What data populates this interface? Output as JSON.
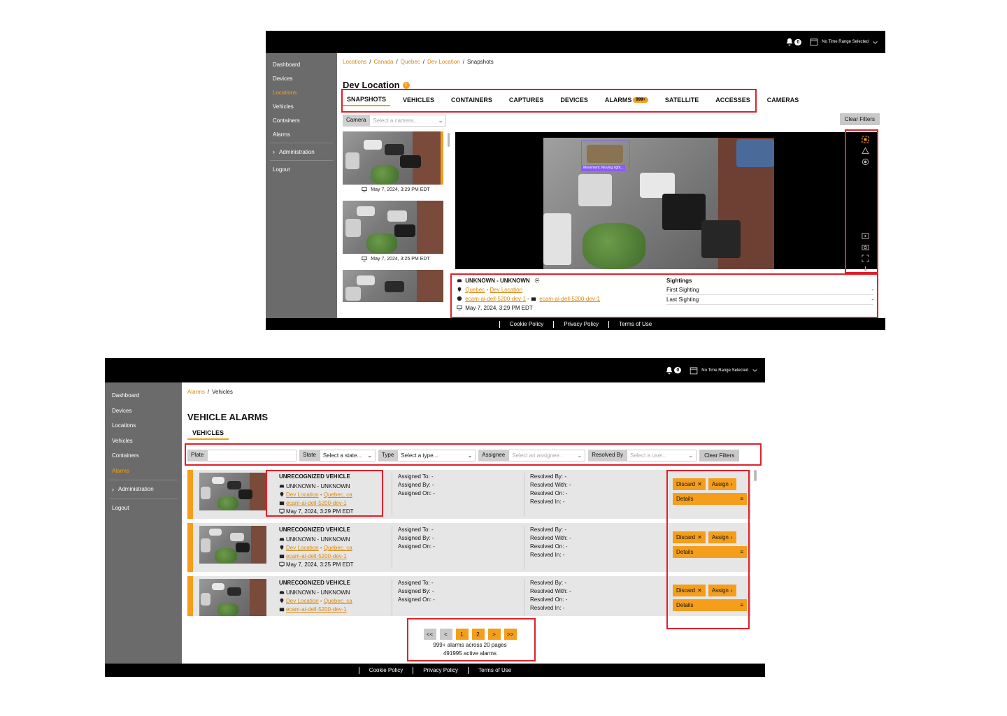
{
  "header": {
    "notification_count": "0",
    "time_range": "No Time Range Selected"
  },
  "sidebar": {
    "items": [
      "Dashboard",
      "Devices",
      "Locations",
      "Vehicles",
      "Containers",
      "Alarms"
    ],
    "administration": "Administration",
    "logout": "Logout"
  },
  "footer": {
    "cookie": "Cookie Policy",
    "privacy": "Privacy Policy",
    "terms": "Terms of Use"
  },
  "snapshots_page": {
    "breadcrumb": [
      "Locations",
      "Canada",
      "Quebec",
      "Dev Location",
      "Snapshots"
    ],
    "title": "Dev Location",
    "warning_glyph": "!",
    "tabs": [
      "SNAPSHOTS",
      "VEHICLES",
      "CONTAINERS",
      "CAPTURES",
      "DEVICES",
      "ALARMS",
      "SATELLITE",
      "ACCESSES",
      "CAMERAS"
    ],
    "alarms_badge": "999+",
    "camera_label": "Camera",
    "camera_placeholder": "Select a camera...",
    "clear_filters": "Clear Filters",
    "thumbnails": [
      "May 7, 2024, 3:29 PM EDT",
      "May 7, 2024, 3:25 PM EDT",
      ""
    ],
    "detection_label": "Movement: Moving right...",
    "info": {
      "vehicle": "UNKNOWN - UNKNOWN",
      "location_region": "Quebec",
      "location_name": "Dev Location",
      "device": "ecam-ai-dell-5200-dev-1",
      "camera": "ecam-ai-dell-5200-dev-1",
      "timestamp": "May 7, 2024, 3:29 PM EDT",
      "sightings_title": "Sightings",
      "first_sighting": "First Sighting",
      "first_sighting_value": "-",
      "last_sighting": "Last Sighting",
      "last_sighting_value": "-"
    }
  },
  "alarms_page": {
    "breadcrumb": [
      "Alarms",
      "Vehicles"
    ],
    "title": "VEHICLE ALARMS",
    "tab": "VEHICLES",
    "filters": {
      "plate_label": "Plate",
      "plate_value": "",
      "state_label": "State",
      "state_value": "Select a state...",
      "type_label": "Type",
      "type_value": "Select a type...",
      "assignee_label": "Assignee",
      "assignee_placeholder": "Select an assignee...",
      "resolved_by_label": "Resolved By",
      "resolved_by_placeholder": "Select a user...",
      "clear": "Clear Filters"
    },
    "alarms": [
      {
        "title": "UNRECOGNIZED VEHICLE",
        "vehicle": "UNKNOWN - UNKNOWN",
        "location": "Dev Location",
        "region": "Quebec, ca",
        "camera": "ecam-ai-dell-5200-dev-1",
        "timestamp": "May 7, 2024, 3:29 PM EDT",
        "assigned_to": "Assigned To: -",
        "assigned_by": "Assigned By: -",
        "assigned_on": "Assigned On: -",
        "resolved_by": "Resolved By: -",
        "resolved_with": "Resolved With: -",
        "resolved_on": "Resolved On: -",
        "resolved_in": "Resolved In: -"
      },
      {
        "title": "UNRECOGNIZED VEHICLE",
        "vehicle": "UNKNOWN - UNKNOWN",
        "location": "Dev Location",
        "region": "Quebec, ca",
        "camera": "ecam-ai-dell-5200-dev-1",
        "timestamp": "May 7, 2024, 3:25 PM EDT",
        "assigned_to": "Assigned To: -",
        "assigned_by": "Assigned By: -",
        "assigned_on": "Assigned On: -",
        "resolved_by": "Resolved By: -",
        "resolved_with": "Resolved With: -",
        "resolved_on": "Resolved On: -",
        "resolved_in": "Resolved In: -"
      },
      {
        "title": "UNRECOGNIZED VEHICLE",
        "vehicle": "UNKNOWN - UNKNOWN",
        "location": "Dev Location",
        "region": "Quebec, ca",
        "camera": "ecam-ai-dell-5200-dev-1",
        "timestamp": "",
        "assigned_to": "Assigned To: -",
        "assigned_by": "Assigned By: -",
        "assigned_on": "Assigned On: -",
        "resolved_by": "Resolved By: -",
        "resolved_with": "Resolved With: -",
        "resolved_on": "Resolved On: -",
        "resolved_in": "Resolved In: -"
      }
    ],
    "actions": {
      "discard": "Discard",
      "assign": "Assign",
      "details": "Details"
    },
    "pagination": {
      "first": "<<",
      "prev": "<",
      "pages": [
        "1",
        "2"
      ],
      "next": ">",
      "last": ">>",
      "summary": "999+ alarms across 20 pages",
      "active": "491995 active alarms"
    }
  },
  "colors": {
    "accent": "#f59e1b",
    "sidebar": "#6b6b6b",
    "highlight_box": "#e0202a",
    "detection_box": "#8b5cf6"
  }
}
